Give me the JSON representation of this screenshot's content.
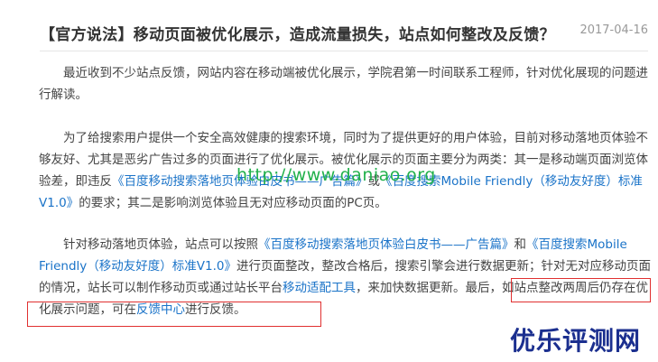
{
  "article": {
    "title": "【官方说法】移动页面被优化展示，造成流量损失，站点如何整改及反馈？",
    "date": "2017-04-16",
    "p1": "最近收到不少站点反馈，网站内容在移动端被优化展示，学院君第一时间联系工程师，针对优化展现的问题进行解读。",
    "p2": {
      "text1": "为了给搜索用户提供一个安全高效健康的搜索环境，同时为了提供更好的用户体验，目前对移动落地页体验不够友好、尤其是恶劣广告过多的页面进行了优化展示。被优化展示的页面主要分为两类：其一是移动端页面浏览体验差，即违反",
      "link1": "《百度移动搜索落地页体验白皮书——广告篇》",
      "text2": "或",
      "link2": "《百度搜索Mobile Friendly（移动友好度）标准V1.0》",
      "text3": "的要求；其二是影响浏览体验且无对应移动页面的PC页。"
    },
    "p3": {
      "text1": "针对移动落地页体验，站点可以按照",
      "link1": "《百度移动搜索落地页体验白皮书——广告篇》",
      "text2": "和",
      "link2": "《百度搜索Mobile Friendly（移动友好度）标准V1.0》",
      "text3": "进行页面整改，整改合格后，搜索引擎会进行数据更新；针对无对应移动页面的情况，站长可以制作移动页或通过站长平台",
      "link3": "移动适配工具",
      "text4": "，来加快数据更新。最后，如站点整改两周后仍存在优化展示问题，可在",
      "link4": "反馈中心",
      "text5": "进行反馈。"
    }
  },
  "watermarks": {
    "url": "http://www.daniao.org",
    "brand": "优乐评测网"
  }
}
